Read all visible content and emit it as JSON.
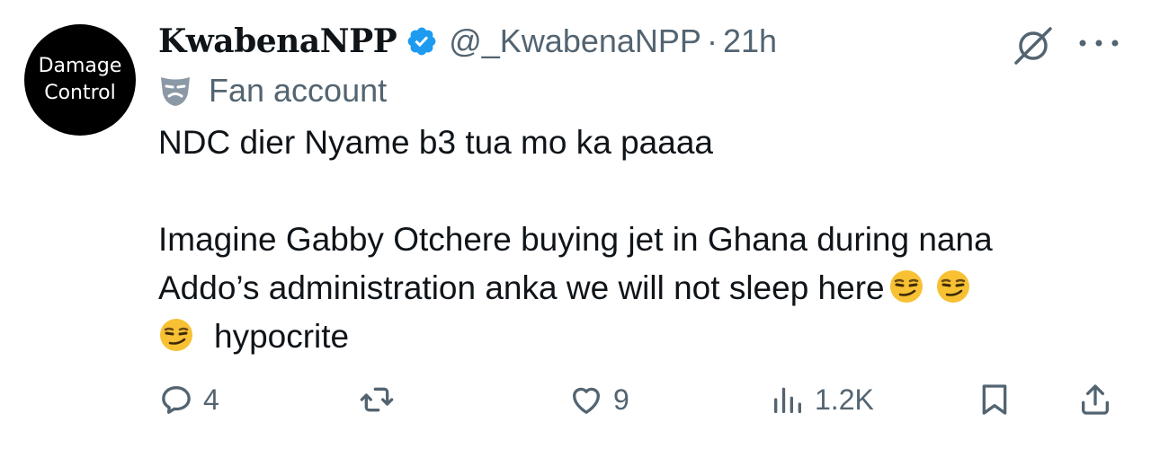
{
  "avatar": {
    "line1": "Damage",
    "line2": "Control"
  },
  "author": {
    "display_name": "KwabenaNPP",
    "handle": "@_KwabenaNPP",
    "time": "21h",
    "verified_color": "#1d9bf0"
  },
  "affiliation": {
    "label": "Fan account",
    "icon": "mask-icon"
  },
  "tweet": {
    "line1": "NDC dier Nyame b3 tua mo ka paaaa",
    "line2": "Imagine Gabby Otchere buying jet in Ghana during nana",
    "line3": "Addo’s administration anka we will not sleep here",
    "line4": "hypocrite",
    "emoji": "smirking-face"
  },
  "actions": {
    "replies": "4",
    "likes": "9",
    "views": "1.2K",
    "icons": [
      "reply-icon",
      "retweet-icon",
      "like-icon",
      "views-icon",
      "bookmark-icon",
      "share-icon"
    ]
  },
  "colors": {
    "text": "#0f1419",
    "secondary": "#536471",
    "accent": "#1d9bf0"
  }
}
